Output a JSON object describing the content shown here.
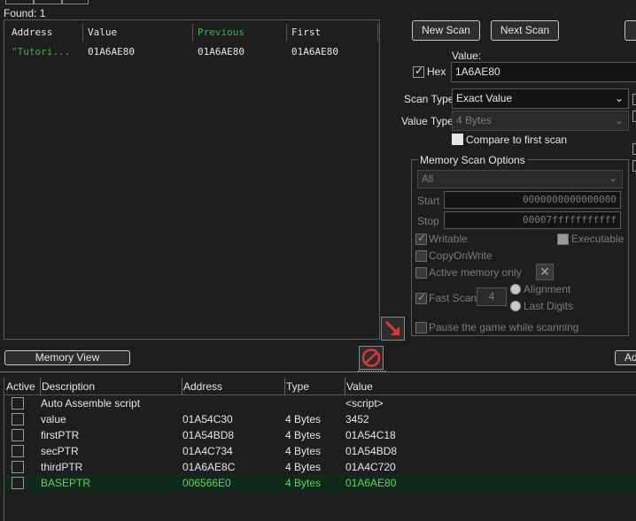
{
  "found": {
    "label": "Found: 1"
  },
  "results": {
    "columns": [
      "Address",
      "Value",
      "Previous",
      "First"
    ],
    "rows": [
      {
        "address": "\"Tutori...",
        "value": "01A6AE80",
        "previous": "01A6AE80",
        "first": "01A6AE80"
      }
    ]
  },
  "scan": {
    "new_scan": "New Scan",
    "next_scan": "Next Scan",
    "value_label": "Value:",
    "hex_label": "Hex",
    "value_input": "1A6AE80",
    "scan_type_label": "Scan Type",
    "scan_type_value": "Exact Value",
    "value_type_label": "Value Type",
    "value_type_value": "4 Bytes",
    "compare_first": "Compare to first scan"
  },
  "memory_options": {
    "title": "Memory Scan Options",
    "region": "All",
    "start_label": "Start",
    "start_value": "0000000000000000",
    "stop_label": "Stop",
    "stop_value": "00007fffffffffff",
    "writable": "Writable",
    "executable": "Executable",
    "copy_on_write": "CopyOnWrite",
    "active_memory": "Active memory only",
    "fast_scan": "Fast Scan",
    "fast_scan_value": "4",
    "alignment": "Alignment",
    "last_digits": "Last Digits",
    "pause_game": "Pause the game while scanning"
  },
  "toolbar": {
    "memory_view": "Memory View",
    "add_right": "Ad"
  },
  "address_list": {
    "columns": [
      "Active",
      "Description",
      "Address",
      "Type",
      "Value"
    ],
    "rows": [
      {
        "description": "Auto Assemble script",
        "address": "",
        "type": "",
        "value": "<script>"
      },
      {
        "description": "value",
        "address": "01A54C30",
        "type": "4 Bytes",
        "value": "3452"
      },
      {
        "description": "firstPTR",
        "address": "01A54BD8",
        "type": "4 Bytes",
        "value": "01A54C18"
      },
      {
        "description": "secPTR",
        "address": "01A4C734",
        "type": "4 Bytes",
        "value": "01A54BD8"
      },
      {
        "description": "thirdPTR",
        "address": "01A6AE8C",
        "type": "4 Bytes",
        "value": "01A4C720"
      },
      {
        "description": "BASEPTR",
        "address": "006566E0",
        "type": "4 Bytes",
        "value": "01A6AE80"
      }
    ]
  },
  "colors": {
    "accent_green": "#5fd35f",
    "prev_green": "#3cb043",
    "arrow_red": "#d83a3a"
  }
}
